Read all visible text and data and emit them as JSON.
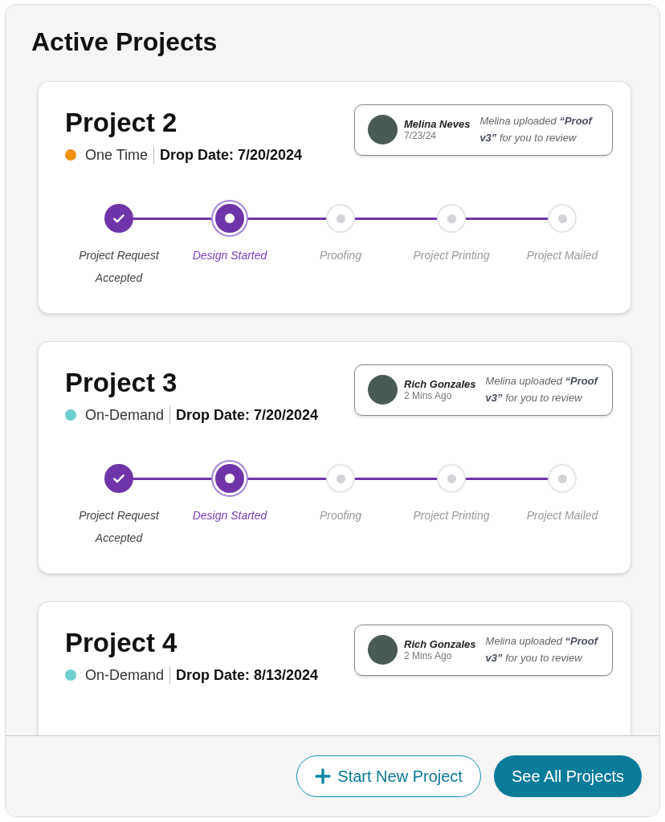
{
  "title": "Active Projects",
  "projects": [
    {
      "name": "Project 2",
      "type": {
        "label": "One Time",
        "color": "#f0900f"
      },
      "drop_date": "Drop Date: 7/20/2024",
      "notification": {
        "user": "Melina Neves",
        "time": "7/23/24",
        "message": "Melina uploaded **“Proof v3”** for you to review"
      },
      "steps": [
        {
          "label": "Project Request Accepted",
          "kind": "done"
        },
        {
          "label": "Design Started",
          "kind": "current"
        },
        {
          "label": "Proofing",
          "kind": "pending"
        },
        {
          "label": "Project Printing",
          "kind": "pending"
        },
        {
          "label": "Project Mailed",
          "kind": "pending"
        }
      ]
    },
    {
      "name": "Project 3",
      "type": {
        "label": "On-Demand",
        "color": "#6fcfcf"
      },
      "drop_date": "Drop Date: 7/20/2024",
      "notification": {
        "user": "Rich Gonzales",
        "time": "2 Mins Ago",
        "message": "Melina uploaded **“Proof v3”** for you to review"
      },
      "steps": [
        {
          "label": "Project Request Accepted",
          "kind": "done"
        },
        {
          "label": "Design Started",
          "kind": "current"
        },
        {
          "label": "Proofing",
          "kind": "pending"
        },
        {
          "label": "Project Printing",
          "kind": "pending"
        },
        {
          "label": "Project Mailed",
          "kind": "pending"
        }
      ]
    },
    {
      "name": "Project 4",
      "type": {
        "label": "On-Demand",
        "color": "#6fcfcf"
      },
      "drop_date": "Drop Date: 8/13/2024",
      "notification": {
        "user": "Rich Gonzales",
        "time": "2 Mins Ago",
        "message": "Melina uploaded **“Proof v3”** for you to review"
      }
    }
  ],
  "buttons": [
    {
      "label": "Start New Project",
      "kind": "outline"
    },
    {
      "label": "See All Projects",
      "kind": "filled"
    }
  ]
}
